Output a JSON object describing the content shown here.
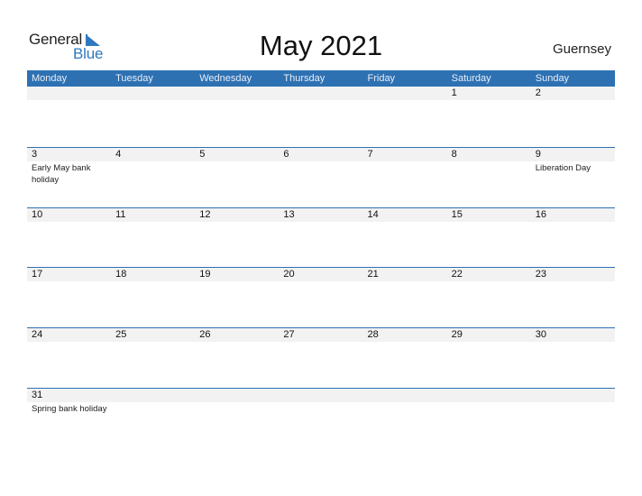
{
  "logo": {
    "word1": "General",
    "word2": "Blue"
  },
  "title": "May 2021",
  "country": "Guernsey",
  "colors": {
    "header_bg": "#2e71b3",
    "header_text": "#e8eef6",
    "number_bar": "#f2f2f2",
    "accent": "#2f78c0"
  },
  "weekdays": [
    "Monday",
    "Tuesday",
    "Wednesday",
    "Thursday",
    "Friday",
    "Saturday",
    "Sunday"
  ],
  "weeks": [
    {
      "days": [
        {
          "num": "",
          "event": ""
        },
        {
          "num": "",
          "event": ""
        },
        {
          "num": "",
          "event": ""
        },
        {
          "num": "",
          "event": ""
        },
        {
          "num": "",
          "event": ""
        },
        {
          "num": "1",
          "event": ""
        },
        {
          "num": "2",
          "event": ""
        }
      ]
    },
    {
      "days": [
        {
          "num": "3",
          "event": "Early May bank holiday"
        },
        {
          "num": "4",
          "event": ""
        },
        {
          "num": "5",
          "event": ""
        },
        {
          "num": "6",
          "event": ""
        },
        {
          "num": "7",
          "event": ""
        },
        {
          "num": "8",
          "event": ""
        },
        {
          "num": "9",
          "event": "Liberation Day"
        }
      ]
    },
    {
      "days": [
        {
          "num": "10",
          "event": ""
        },
        {
          "num": "11",
          "event": ""
        },
        {
          "num": "12",
          "event": ""
        },
        {
          "num": "13",
          "event": ""
        },
        {
          "num": "14",
          "event": ""
        },
        {
          "num": "15",
          "event": ""
        },
        {
          "num": "16",
          "event": ""
        }
      ]
    },
    {
      "days": [
        {
          "num": "17",
          "event": ""
        },
        {
          "num": "18",
          "event": ""
        },
        {
          "num": "19",
          "event": ""
        },
        {
          "num": "20",
          "event": ""
        },
        {
          "num": "21",
          "event": ""
        },
        {
          "num": "22",
          "event": ""
        },
        {
          "num": "23",
          "event": ""
        }
      ]
    },
    {
      "days": [
        {
          "num": "24",
          "event": ""
        },
        {
          "num": "25",
          "event": ""
        },
        {
          "num": "26",
          "event": ""
        },
        {
          "num": "27",
          "event": ""
        },
        {
          "num": "28",
          "event": ""
        },
        {
          "num": "29",
          "event": ""
        },
        {
          "num": "30",
          "event": ""
        }
      ]
    },
    {
      "days": [
        {
          "num": "31",
          "event": "Spring bank holiday"
        },
        {
          "num": "",
          "event": ""
        },
        {
          "num": "",
          "event": ""
        },
        {
          "num": "",
          "event": ""
        },
        {
          "num": "",
          "event": ""
        },
        {
          "num": "",
          "event": ""
        },
        {
          "num": "",
          "event": ""
        }
      ]
    }
  ]
}
